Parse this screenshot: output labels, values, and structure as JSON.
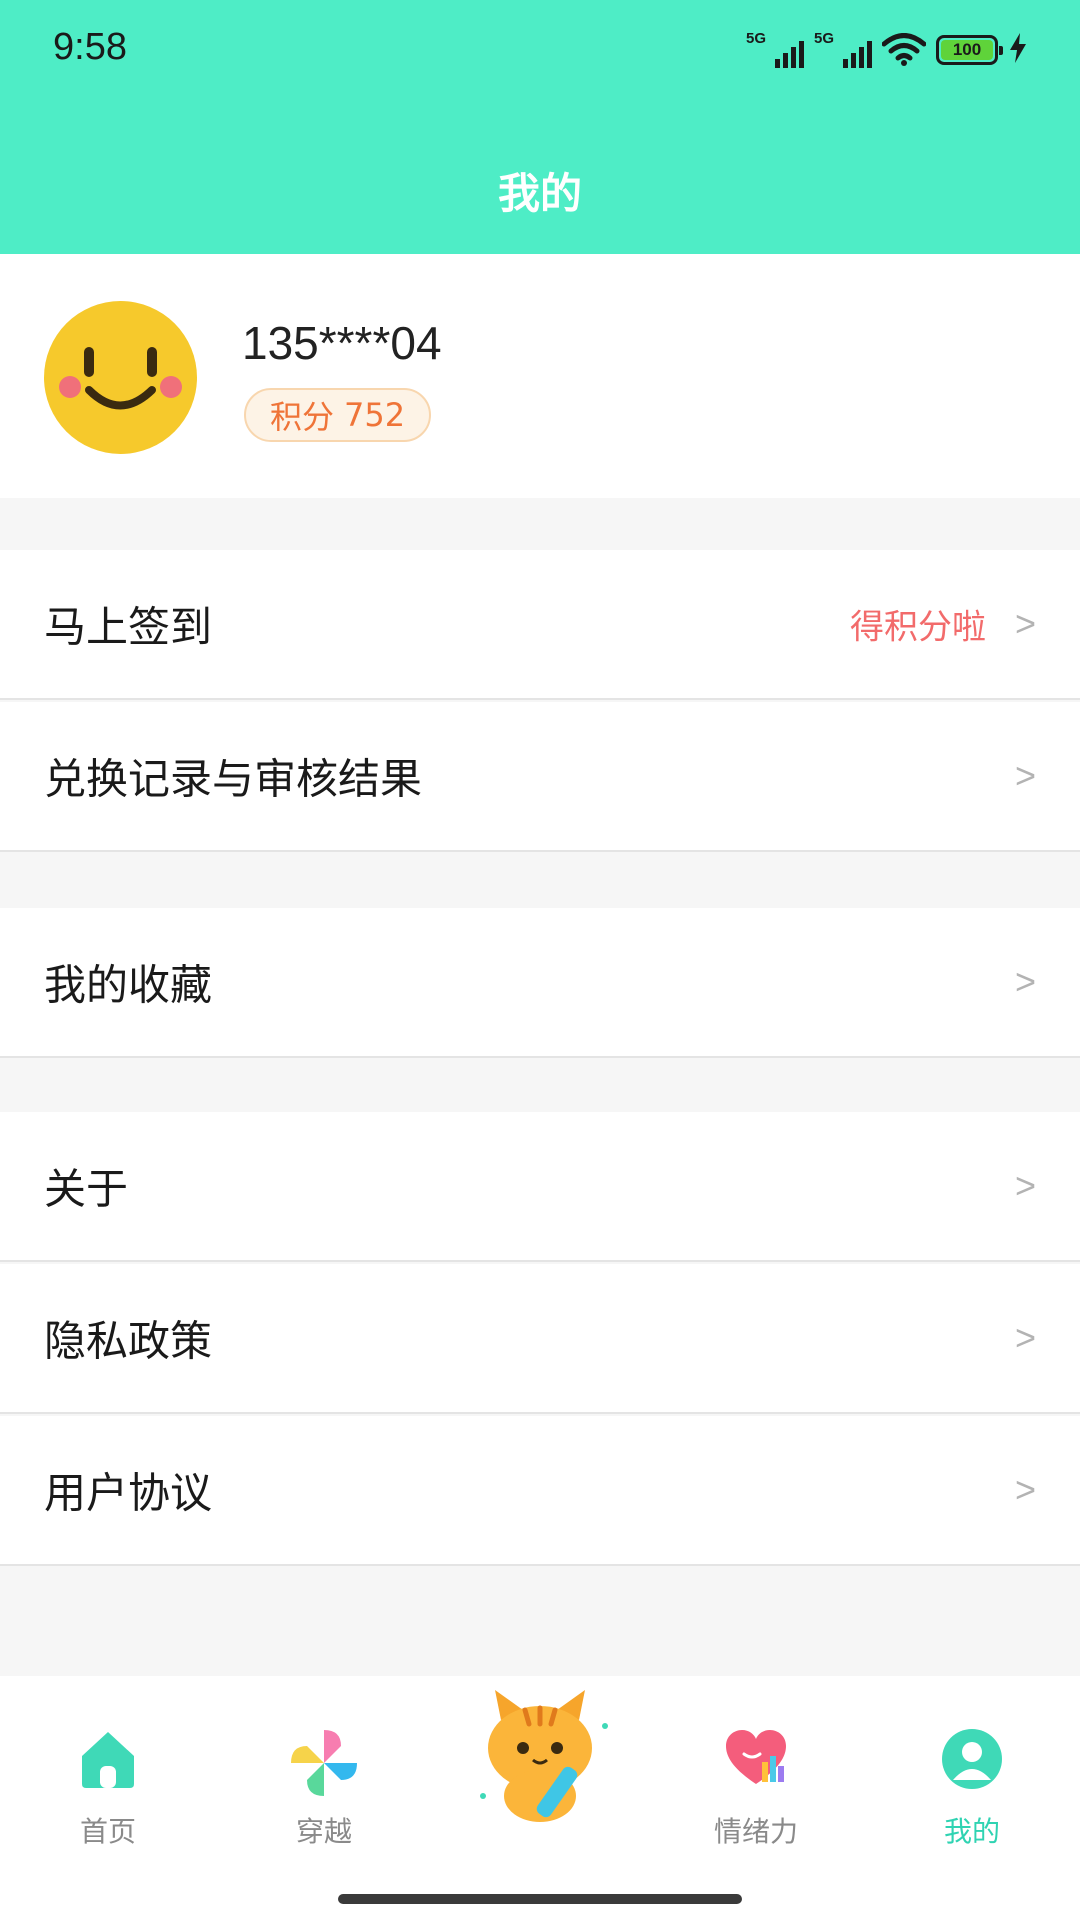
{
  "status_bar": {
    "time": "9:58",
    "network_1": "5G",
    "network_2": "5G",
    "battery": "100"
  },
  "header": {
    "title": "我的"
  },
  "profile": {
    "username": "135****04",
    "points_label": "积分",
    "points_value": "752"
  },
  "menu": {
    "sign_in": {
      "label": "马上签到",
      "hint": "得积分啦",
      "chevron": ">"
    },
    "exchange_records": {
      "label": "兑换记录与审核结果",
      "chevron": ">"
    },
    "favorites": {
      "label": "我的收藏",
      "chevron": ">"
    },
    "about": {
      "label": "关于",
      "chevron": ">"
    },
    "privacy": {
      "label": "隐私政策",
      "chevron": ">"
    },
    "agreement": {
      "label": "用户协议",
      "chevron": ">"
    }
  },
  "bottom_nav": {
    "items": [
      {
        "label": "首页",
        "icon": "home-icon"
      },
      {
        "label": "穿越",
        "icon": "pinwheel-icon"
      },
      {
        "label": "",
        "icon": "cat-mascot-icon"
      },
      {
        "label": "情绪力",
        "icon": "heart-chart-icon"
      },
      {
        "label": "我的",
        "icon": "user-icon",
        "active": true
      }
    ]
  },
  "colors": {
    "header_bg": "#4eedc6",
    "accent": "#2fd3b2",
    "points_text": "#ef7438",
    "hint_text": "#f26b6b"
  }
}
